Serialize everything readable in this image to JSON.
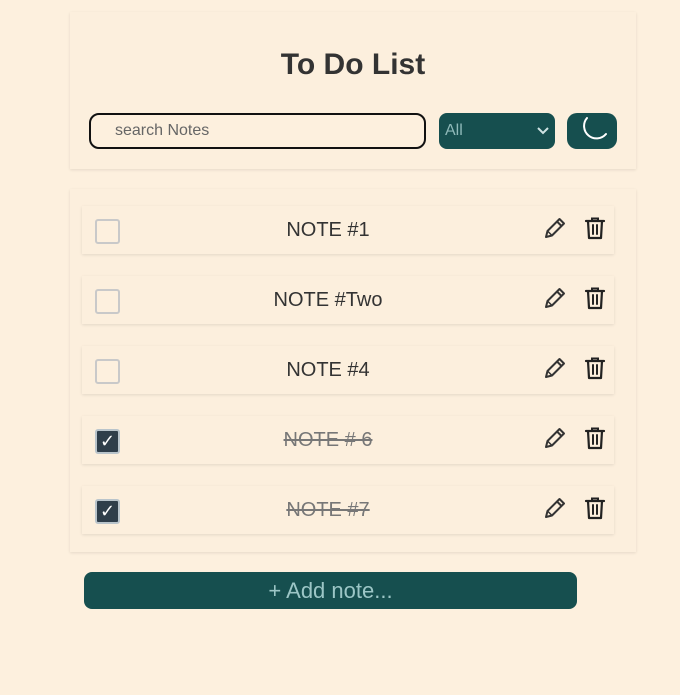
{
  "header": {
    "title": "To Do List",
    "search_placeholder": "search Notes",
    "filter_value": "All",
    "theme_icon": "moon-icon"
  },
  "notes": [
    {
      "text": "NOTE #1",
      "done": false
    },
    {
      "text": "NOTE #Two",
      "done": false
    },
    {
      "text": "NOTE #4",
      "done": false
    },
    {
      "text": "NOTE # 6",
      "done": true
    },
    {
      "text": "NOTE #7",
      "done": true
    }
  ],
  "footer": {
    "add_label": "+ Add note..."
  },
  "check_glyph": "✓",
  "colors": {
    "accent": "#164f4f",
    "background": "#fdf0de",
    "checked": "#2f3e4a"
  }
}
